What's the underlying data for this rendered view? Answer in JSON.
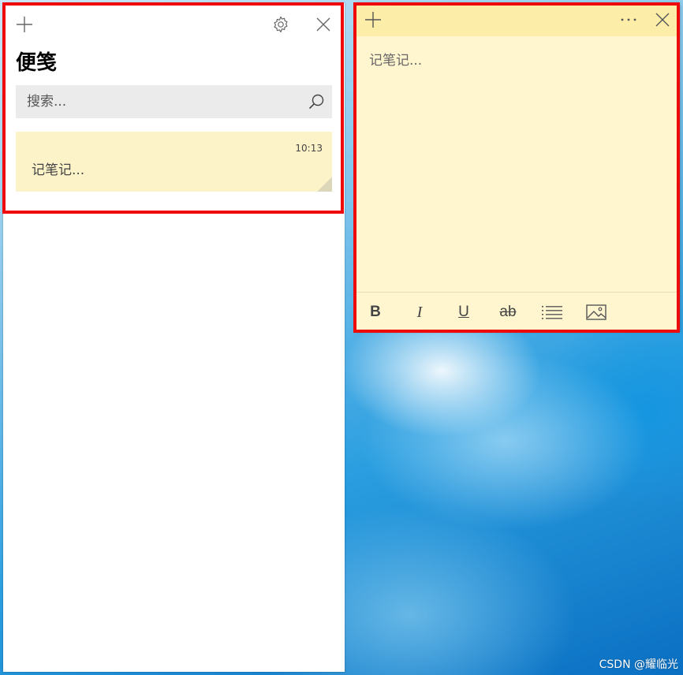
{
  "list_panel": {
    "title": "便笺",
    "add_icon": "plus-icon",
    "settings_icon": "gear-icon",
    "close_icon": "close-icon",
    "search": {
      "placeholder": "搜索...",
      "icon": "search-icon"
    },
    "notes": [
      {
        "time": "10:13",
        "preview": "记笔记..."
      }
    ]
  },
  "note_window": {
    "add_icon": "plus-icon",
    "menu_icon": "more-icon",
    "close_icon": "close-icon",
    "placeholder": "记笔记...",
    "toolbar": {
      "bold_label": "B",
      "italic_label": "I",
      "underline_label": "U",
      "strike_label": "ab",
      "list_icon": "bullet-list-icon",
      "image_icon": "image-icon"
    }
  },
  "watermark": "CSDN @耀临光",
  "colors": {
    "highlight": "#ee0a0a",
    "note_body": "#fff5cf",
    "note_header": "#fceea8",
    "note_card": "#fdf3c9"
  }
}
